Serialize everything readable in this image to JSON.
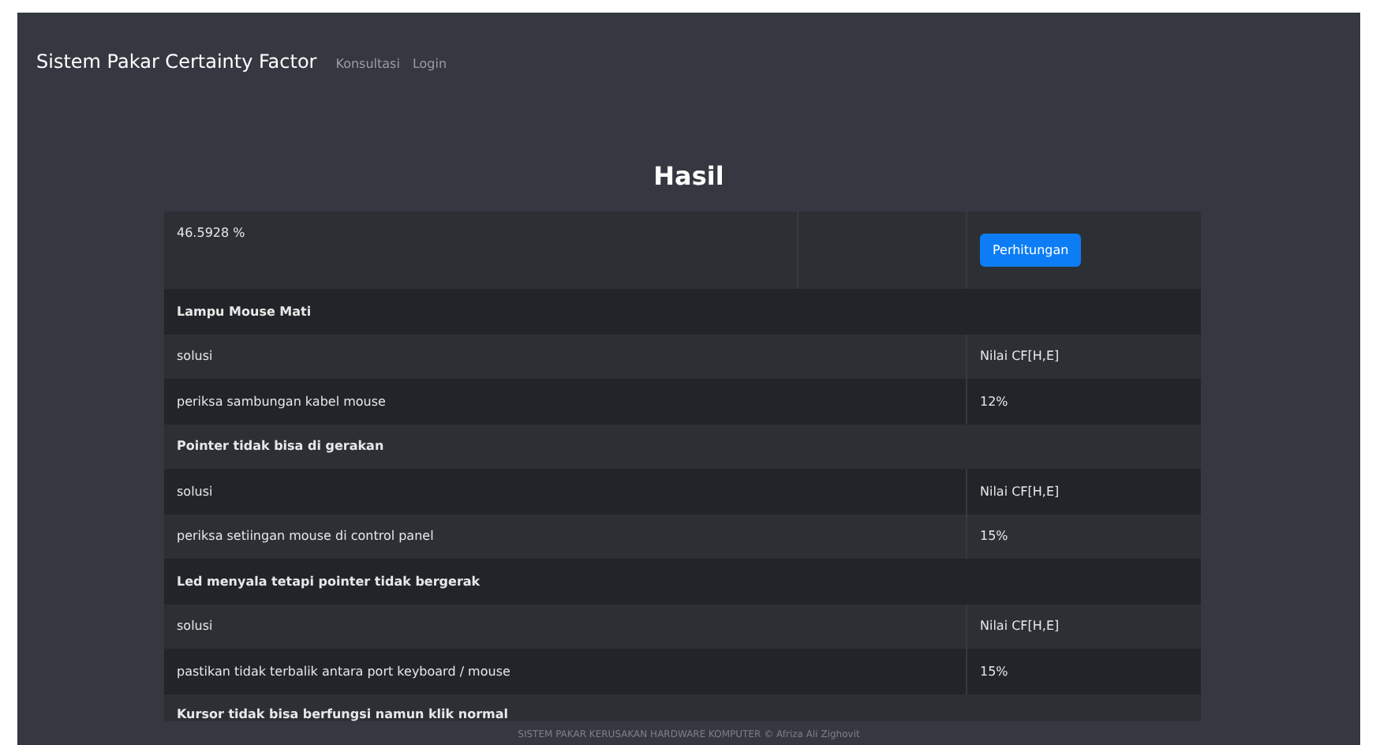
{
  "navbar": {
    "brand": "Sistem Pakar Certainty Factor",
    "links": [
      "Konsultasi",
      "Login"
    ]
  },
  "heading": "Hasil",
  "result": {
    "value": "46.5928 %",
    "button": "Perhitungan"
  },
  "groups": [
    {
      "title": "Lampu Mouse Mati",
      "header": [
        "solusi",
        "Nilai CF[H,E]"
      ],
      "rows": [
        {
          "solution": "periksa sambungan kabel mouse",
          "cf": "12%"
        }
      ]
    },
    {
      "title": "Pointer tidak bisa di gerakan",
      "header": [
        "solusi",
        "Nilai CF[H,E]"
      ],
      "rows": [
        {
          "solution": "periksa setiingan mouse di control panel",
          "cf": "15%"
        }
      ]
    },
    {
      "title": "Led menyala tetapi pointer tidak bergerak",
      "header": [
        "solusi",
        "Nilai CF[H,E]"
      ],
      "rows": [
        {
          "solution": "pastikan tidak terbalik antara port keyboard / mouse",
          "cf": "15%"
        }
      ]
    },
    {
      "title": "Kursor tidak bisa berfungsi namun klik normal"
    }
  ],
  "footer": "SISTEM PAKAR KERUSAKAN HARDWARE KOMPUTER © Afriza Ali Zighovit"
}
